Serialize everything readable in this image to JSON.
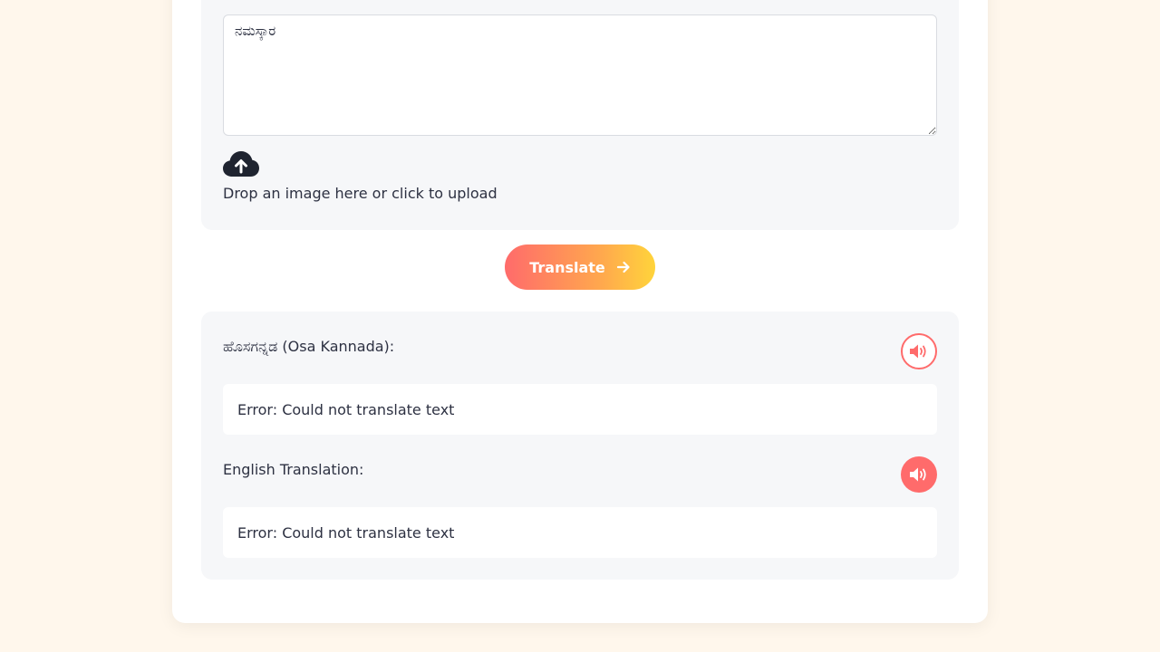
{
  "input": {
    "text": "ನಮಸ್ಕಾರ",
    "upload_label": "Drop an image here or click to upload",
    "upload_icon": "cloud-upload-icon"
  },
  "translate_button": {
    "label": "Translate",
    "icon": "arrow-right-icon"
  },
  "output": {
    "kannada": {
      "label": "ಹೊಸಗನ್ನಡ (Osa Kannada):",
      "result": "Error: Could not translate text",
      "speak_icon": "speaker-icon"
    },
    "english": {
      "label": "English Translation:",
      "result": "Error: Could not translate text",
      "speak_icon": "speaker-icon"
    }
  },
  "colors": {
    "background": "#fff7ec",
    "accent": "#ff6b6b",
    "gradient_end": "#ffd43b",
    "panel": "#f6f7f9"
  }
}
